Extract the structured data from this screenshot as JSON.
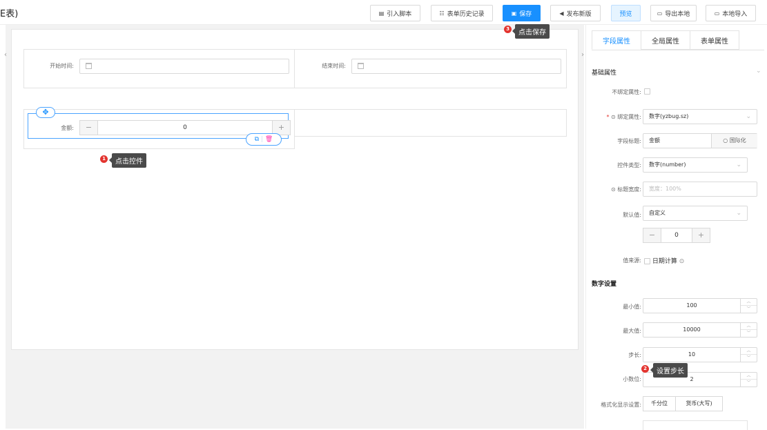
{
  "header": {
    "title": "E表)",
    "buttons": {
      "import_script": "引入脚本",
      "history": "表单历史记录",
      "save": "保存",
      "publish": "发布新版",
      "preview": "预览",
      "export": "导出本地",
      "local_import": "本地导入"
    }
  },
  "tooltips": {
    "step1": {
      "num": "1",
      "text": "点击控件"
    },
    "step2": {
      "num": "2",
      "text": "设置步长"
    },
    "step3": {
      "num": "3",
      "text": "点击保存"
    }
  },
  "canvas": {
    "start_time_label": "开始时间:",
    "end_time_label": "结束时间:",
    "amount_label": "金额:",
    "amount_value": "0",
    "minus": "−",
    "plus": "+"
  },
  "panel": {
    "tabs": [
      "字段属性",
      "全局属性",
      "表单属性"
    ],
    "section_basic": "基础属性",
    "no_bind_label": "不绑定属性:",
    "bind_label": "绑定属性:",
    "bind_value": "数字(yzbug.sz)",
    "field_title_label": "字段标题:",
    "field_title_value": "金额",
    "i18n_label": "国际化",
    "control_type_label": "控件类型:",
    "control_type_value": "数字(number)",
    "title_width_label": "标题宽度:",
    "title_width_placeholder": "宽度：100%",
    "default_label": "默认值:",
    "default_value": "自定义",
    "default_number": "0",
    "value_source_label": "值来源:",
    "date_calc_label": "日期计算",
    "section_number": "数字设置",
    "min_label": "最小值:",
    "min_value": "100",
    "max_label": "最大值:",
    "max_value": "10000",
    "step_label": "步长:",
    "step_value": "10",
    "decimals_label": "小数位:",
    "decimals_value": "2",
    "format_label": "格式化显示设置:",
    "format_options": [
      "千分位",
      "货币(大写)"
    ]
  },
  "colors": {
    "primary": "#1890ff",
    "badge": "#e3342f",
    "tooltip": "#4a4a4a"
  }
}
